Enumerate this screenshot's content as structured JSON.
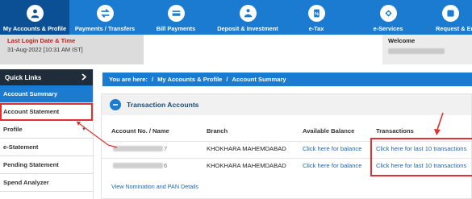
{
  "nav": {
    "items": [
      {
        "label": "My Accounts & Profile",
        "icon": "user-icon"
      },
      {
        "label": "Payments / Transfers",
        "icon": "transfer-icon"
      },
      {
        "label": "Bill Payments",
        "icon": "bill-icon"
      },
      {
        "label": "Deposit & Investment",
        "icon": "investment-icon"
      },
      {
        "label": "e-Tax",
        "icon": "tax-icon"
      },
      {
        "label": "e-Services",
        "icon": "services-icon"
      },
      {
        "label": "Request & En",
        "icon": "request-icon"
      }
    ]
  },
  "info": {
    "last_login_label": "Last Login Date & Time",
    "last_login_value": "31-Aug-2022 [10:31 AM IST]",
    "welcome_label": "Welcome"
  },
  "sidebar": {
    "header": "Quick Links",
    "header_icon": "chevron-right-icon",
    "items": [
      {
        "label": "Account Summary"
      },
      {
        "label": "Account Statement"
      },
      {
        "label": "Profile"
      },
      {
        "label": "e-Statement"
      },
      {
        "label": "Pending Statement"
      },
      {
        "label": "Spend Analyzer"
      }
    ]
  },
  "breadcrumb": {
    "prefix": "You are here:",
    "sep": "/",
    "level1": "My Accounts & Profile",
    "level2": "Account Summary"
  },
  "panel": {
    "title": "Transaction Accounts",
    "columns": [
      "Account No. / Name",
      "Branch",
      "Available Balance",
      "Transactions"
    ],
    "rows": [
      {
        "account_tail": "7",
        "branch": "KHOKHARA MAHEMDABAD",
        "balance_link": "Click here for balance",
        "tx_link": "Click here for last 10 transactions"
      },
      {
        "account_tail": "6",
        "branch": "KHOKHARA MAHEMDABAD",
        "balance_link": "Click here for balance",
        "tx_link": "Click here for last 10 transactions"
      }
    ],
    "footer_link": "View Nomination and PAN Details"
  },
  "colors": {
    "primary": "#1a7bd0",
    "active_nav": "#0b4f94",
    "highlight": "#e23030",
    "dark": "#1f2d3a"
  }
}
